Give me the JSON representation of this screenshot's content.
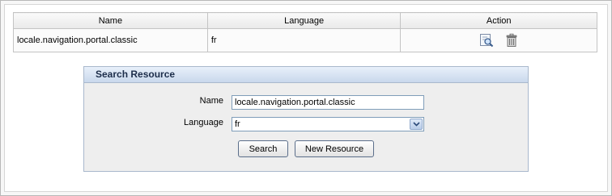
{
  "table": {
    "headers": {
      "name": "Name",
      "language": "Language",
      "action": "Action"
    },
    "rows": [
      {
        "name": "locale.navigation.portal.classic",
        "language": "fr"
      }
    ]
  },
  "search_panel": {
    "title": "Search Resource",
    "name_label": "Name",
    "name_value": "locale.navigation.portal.classic",
    "language_label": "Language",
    "language_value": "fr",
    "search_label": "Search",
    "new_resource_label": "New Resource"
  },
  "icons": {
    "edit": "edit-magnifier-icon",
    "delete": "trash-icon",
    "dropdown": "chevron-down-icon"
  },
  "colors": {
    "panel_header": "#c9d8ec",
    "panel_border": "#a9b8cc",
    "input_border": "#7f9db9"
  }
}
